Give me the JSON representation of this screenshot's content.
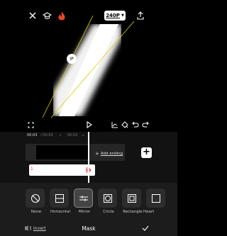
{
  "header": {
    "resolution_label": "240P"
  },
  "canvas": {
    "pivot_label": "IP"
  },
  "timeline": {
    "current_time": "00:03",
    "total_time": "/ 00:03",
    "tick_label": "00:02",
    "add_ending_label": "Add ending",
    "clip_label": "1"
  },
  "mask_panel": {
    "title": "Mask",
    "invert_label": "Invert",
    "options": [
      {
        "label": "None"
      },
      {
        "label": "Horizontal"
      },
      {
        "label": "Mirror"
      },
      {
        "label": "Circle"
      },
      {
        "label": "Rectangle"
      },
      {
        "label": "Heart"
      }
    ],
    "selected": "Mirror"
  },
  "colors": {
    "accent": "#e8452c",
    "mask_line": "#d8d000",
    "background": "#000000"
  }
}
